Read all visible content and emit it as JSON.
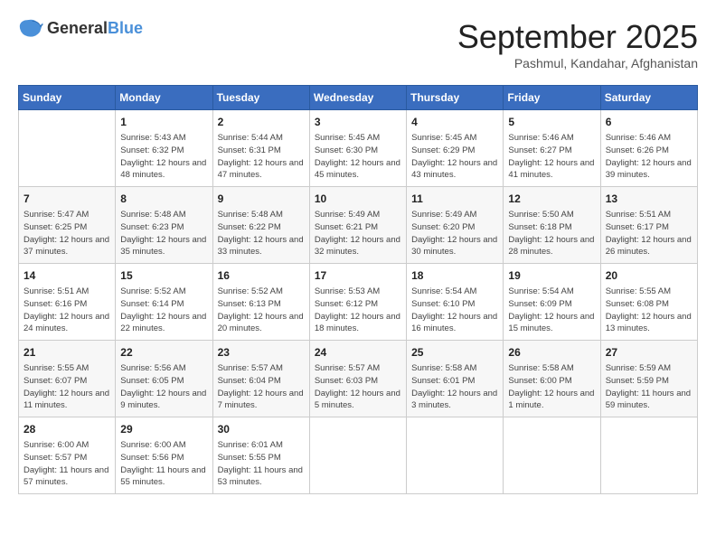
{
  "header": {
    "logo_general": "General",
    "logo_blue": "Blue",
    "month_title": "September 2025",
    "location": "Pashmul, Kandahar, Afghanistan"
  },
  "days_of_week": [
    "Sunday",
    "Monday",
    "Tuesday",
    "Wednesday",
    "Thursday",
    "Friday",
    "Saturday"
  ],
  "weeks": [
    [
      {
        "day": null
      },
      {
        "day": "1",
        "sunrise": "5:43 AM",
        "sunset": "6:32 PM",
        "daylight": "12 hours and 48 minutes."
      },
      {
        "day": "2",
        "sunrise": "5:44 AM",
        "sunset": "6:31 PM",
        "daylight": "12 hours and 47 minutes."
      },
      {
        "day": "3",
        "sunrise": "5:45 AM",
        "sunset": "6:30 PM",
        "daylight": "12 hours and 45 minutes."
      },
      {
        "day": "4",
        "sunrise": "5:45 AM",
        "sunset": "6:29 PM",
        "daylight": "12 hours and 43 minutes."
      },
      {
        "day": "5",
        "sunrise": "5:46 AM",
        "sunset": "6:27 PM",
        "daylight": "12 hours and 41 minutes."
      },
      {
        "day": "6",
        "sunrise": "5:46 AM",
        "sunset": "6:26 PM",
        "daylight": "12 hours and 39 minutes."
      }
    ],
    [
      {
        "day": "7",
        "sunrise": "5:47 AM",
        "sunset": "6:25 PM",
        "daylight": "12 hours and 37 minutes."
      },
      {
        "day": "8",
        "sunrise": "5:48 AM",
        "sunset": "6:23 PM",
        "daylight": "12 hours and 35 minutes."
      },
      {
        "day": "9",
        "sunrise": "5:48 AM",
        "sunset": "6:22 PM",
        "daylight": "12 hours and 33 minutes."
      },
      {
        "day": "10",
        "sunrise": "5:49 AM",
        "sunset": "6:21 PM",
        "daylight": "12 hours and 32 minutes."
      },
      {
        "day": "11",
        "sunrise": "5:49 AM",
        "sunset": "6:20 PM",
        "daylight": "12 hours and 30 minutes."
      },
      {
        "day": "12",
        "sunrise": "5:50 AM",
        "sunset": "6:18 PM",
        "daylight": "12 hours and 28 minutes."
      },
      {
        "day": "13",
        "sunrise": "5:51 AM",
        "sunset": "6:17 PM",
        "daylight": "12 hours and 26 minutes."
      }
    ],
    [
      {
        "day": "14",
        "sunrise": "5:51 AM",
        "sunset": "6:16 PM",
        "daylight": "12 hours and 24 minutes."
      },
      {
        "day": "15",
        "sunrise": "5:52 AM",
        "sunset": "6:14 PM",
        "daylight": "12 hours and 22 minutes."
      },
      {
        "day": "16",
        "sunrise": "5:52 AM",
        "sunset": "6:13 PM",
        "daylight": "12 hours and 20 minutes."
      },
      {
        "day": "17",
        "sunrise": "5:53 AM",
        "sunset": "6:12 PM",
        "daylight": "12 hours and 18 minutes."
      },
      {
        "day": "18",
        "sunrise": "5:54 AM",
        "sunset": "6:10 PM",
        "daylight": "12 hours and 16 minutes."
      },
      {
        "day": "19",
        "sunrise": "5:54 AM",
        "sunset": "6:09 PM",
        "daylight": "12 hours and 15 minutes."
      },
      {
        "day": "20",
        "sunrise": "5:55 AM",
        "sunset": "6:08 PM",
        "daylight": "12 hours and 13 minutes."
      }
    ],
    [
      {
        "day": "21",
        "sunrise": "5:55 AM",
        "sunset": "6:07 PM",
        "daylight": "12 hours and 11 minutes."
      },
      {
        "day": "22",
        "sunrise": "5:56 AM",
        "sunset": "6:05 PM",
        "daylight": "12 hours and 9 minutes."
      },
      {
        "day": "23",
        "sunrise": "5:57 AM",
        "sunset": "6:04 PM",
        "daylight": "12 hours and 7 minutes."
      },
      {
        "day": "24",
        "sunrise": "5:57 AM",
        "sunset": "6:03 PM",
        "daylight": "12 hours and 5 minutes."
      },
      {
        "day": "25",
        "sunrise": "5:58 AM",
        "sunset": "6:01 PM",
        "daylight": "12 hours and 3 minutes."
      },
      {
        "day": "26",
        "sunrise": "5:58 AM",
        "sunset": "6:00 PM",
        "daylight": "12 hours and 1 minute."
      },
      {
        "day": "27",
        "sunrise": "5:59 AM",
        "sunset": "5:59 PM",
        "daylight": "11 hours and 59 minutes."
      }
    ],
    [
      {
        "day": "28",
        "sunrise": "6:00 AM",
        "sunset": "5:57 PM",
        "daylight": "11 hours and 57 minutes."
      },
      {
        "day": "29",
        "sunrise": "6:00 AM",
        "sunset": "5:56 PM",
        "daylight": "11 hours and 55 minutes."
      },
      {
        "day": "30",
        "sunrise": "6:01 AM",
        "sunset": "5:55 PM",
        "daylight": "11 hours and 53 minutes."
      },
      {
        "day": null
      },
      {
        "day": null
      },
      {
        "day": null
      },
      {
        "day": null
      }
    ]
  ]
}
